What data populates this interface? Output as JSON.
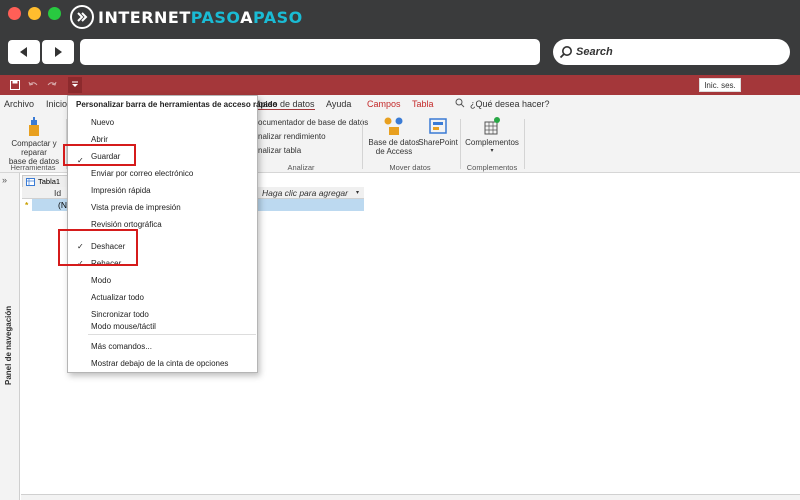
{
  "browser": {
    "logo": {
      "part1": "INTERNET",
      "part2": "PASO",
      "part3": "A",
      "part4": "PASO"
    },
    "search_label": "Search",
    "colors": {
      "chrome": "#3a3b3c",
      "accent": "#1abbd4",
      "close": "#ff5f57",
      "minimize": "#ffbd2e",
      "maximize": "#28c940"
    }
  },
  "titlebar": {
    "signin_label": "Inic. ses.",
    "color": "#a4373a"
  },
  "ribbon": {
    "tabs": {
      "archivo": "Archivo",
      "inicio": "Inicio",
      "base_datos": "base de datos",
      "ayuda": "Ayuda",
      "campos": "Campos",
      "tabla": "Tabla",
      "tell_me": "¿Qué desea hacer?"
    },
    "compact": {
      "line1": "Compactar y reparar",
      "line2": "base de datos"
    },
    "group_herramientas": "Herramientas",
    "analyze": {
      "item1": "ocumentador de base de datos",
      "item2": "nalizar rendimiento",
      "item3": "nalizar tabla",
      "group": "Analizar"
    },
    "move": {
      "access": {
        "line1": "Base de datos",
        "line2": "de Access"
      },
      "sharepoint": "SharePoint",
      "group": "Mover datos"
    },
    "addins": {
      "label": "Complementos",
      "group": "Complementos"
    }
  },
  "navpane": {
    "label": "Panel de navegación",
    "arrow": "»"
  },
  "table": {
    "tab_name": "Tabla1",
    "id_header": "Id",
    "add_header": "Haga clic para agregar",
    "new_row_marker": "*",
    "new_row_value": "(N"
  },
  "menu": {
    "title": "Personalizar barra de herramientas de acceso rápido",
    "items": [
      {
        "label": "Nuevo",
        "checked": ""
      },
      {
        "label": "Abrir",
        "checked": ""
      },
      {
        "label": "Guardar",
        "checked": "✓"
      },
      {
        "label": "Enviar por correo electrónico",
        "checked": ""
      },
      {
        "label": "Impresión rápida",
        "checked": ""
      },
      {
        "label": "Vista previa de impresión",
        "checked": ""
      },
      {
        "label": "Revisión ortográfica",
        "checked": ""
      },
      {
        "label": "Deshacer",
        "checked": "✓"
      },
      {
        "label": "Rehacer",
        "checked": "✓"
      },
      {
        "label": "Modo",
        "checked": ""
      },
      {
        "label": "Actualizar todo",
        "checked": ""
      },
      {
        "label": "Sincronizar todo",
        "checked": ""
      },
      {
        "label": "Modo mouse/táctil",
        "checked": ""
      },
      {
        "label": "Más comandos...",
        "checked": ""
      },
      {
        "label": "Mostrar debajo de la cinta de opciones",
        "checked": ""
      }
    ]
  },
  "highlight_color": "#d51b1b"
}
